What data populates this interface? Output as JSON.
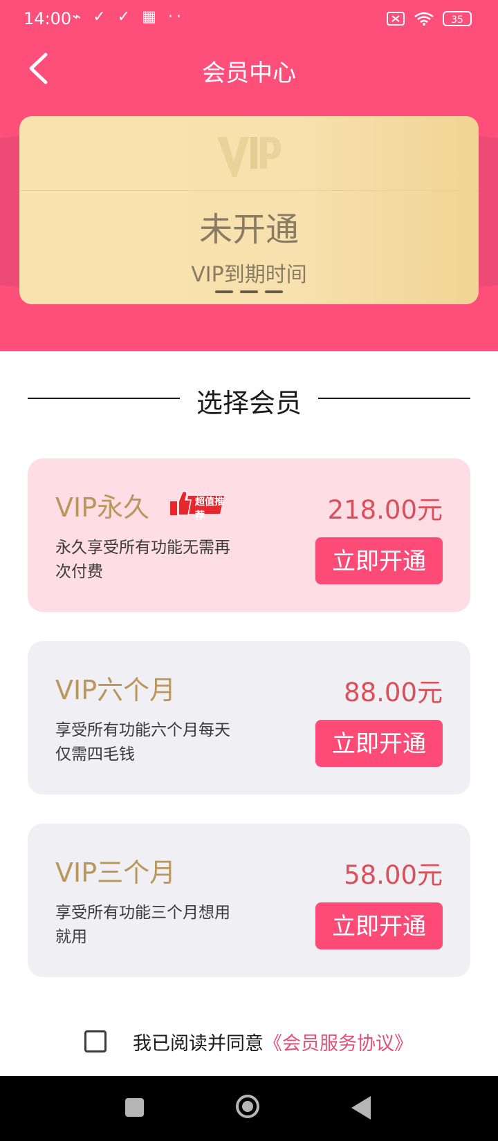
{
  "status_bar": {
    "time": "14:00",
    "left_icons": "⌁ ✓ ✓ ▦ ··",
    "battery": "35"
  },
  "nav": {
    "title": "会员中心"
  },
  "vip_card": {
    "logo": "VIP",
    "status": "未开通",
    "expire_label": "VIP到期时间"
  },
  "section": {
    "title": "选择会员"
  },
  "plans": [
    {
      "name": "VIP永久",
      "badge": "超值推荐",
      "desc": "永久享受所有功能无需再次付费",
      "price": "218.00元",
      "button": "立即开通"
    },
    {
      "name": "VIP六个月",
      "desc": "享受所有功能六个月每天仅需四毛钱",
      "price": "88.00元",
      "button": "立即开通"
    },
    {
      "name": "VIP三个月",
      "desc": "享受所有功能三个月想用就用",
      "price": "58.00元",
      "button": "立即开通"
    }
  ],
  "agreement": {
    "text": "我已阅读并同意",
    "link": "《会员服务协议》"
  },
  "colors": {
    "primary": "#fe4f7b",
    "gold_text": "#b8965c",
    "price": "#d9505a"
  }
}
